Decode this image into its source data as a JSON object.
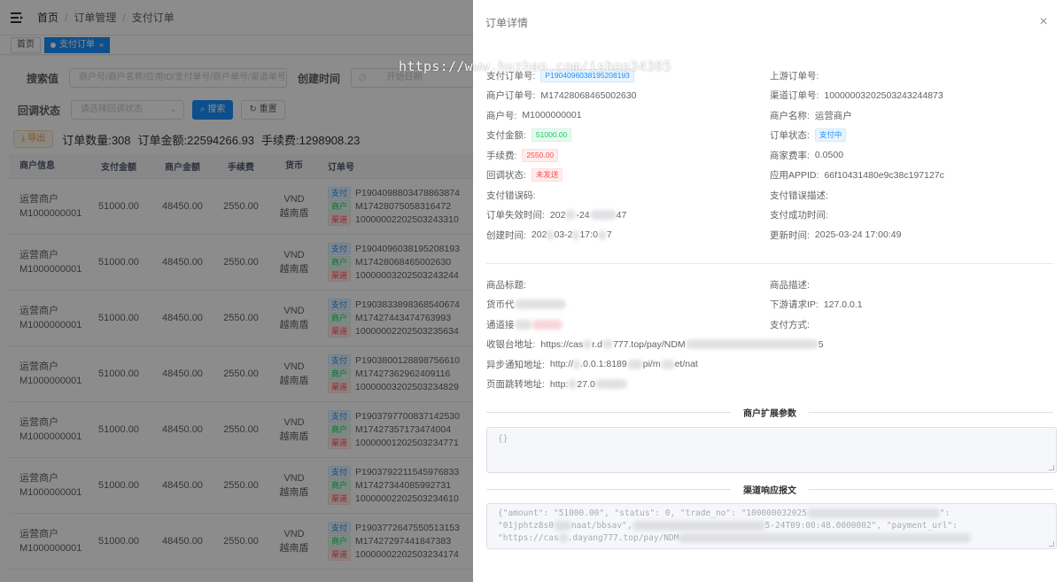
{
  "breadcrumb": {
    "home": "首页",
    "order_mgmt": "订单管理",
    "pay_order": "支付订单"
  },
  "tags": {
    "home": "首页",
    "active": "支付订单",
    "close": "×"
  },
  "filters": {
    "search_label": "搜索值",
    "search_placeholder": "商户号/商户名称/应用ID/支付单号/商户单号/渠道单号",
    "created_label": "创建时间",
    "start_date": "开始日期",
    "callback_label": "回调状态",
    "callback_placeholder": "请选择回调状态",
    "search_btn": "搜索",
    "reset_btn": "重置"
  },
  "summary": {
    "export": "导出",
    "count": "订单数量:308",
    "amount": "订单金额:22594266.93",
    "fee": "手续费:1298908.23"
  },
  "table": {
    "headers": [
      "商户信息",
      "支付金额",
      "商户金额",
      "手续费",
      "货币",
      "订单号"
    ],
    "tag_labels": {
      "pay": "支付",
      "merchant": "商户",
      "channel": "渠道"
    },
    "rows": [
      {
        "name": "运营商户",
        "mid": "M1000000001",
        "pay": "51000.00",
        "merchant": "48450.00",
        "fee": "2550.00",
        "cur": "VND",
        "bank": "越南盾",
        "o1": "P1904098803478863874",
        "o2": "M17428075058316472",
        "o3": "10000002202503243310"
      },
      {
        "name": "运营商户",
        "mid": "M1000000001",
        "pay": "51000.00",
        "merchant": "48450.00",
        "fee": "2550.00",
        "cur": "VND",
        "bank": "越南盾",
        "o1": "P1904096038195208193",
        "o2": "M17428068465002630",
        "o3": "10000003202503243244"
      },
      {
        "name": "运营商户",
        "mid": "M1000000001",
        "pay": "51000.00",
        "merchant": "48450.00",
        "fee": "2550.00",
        "cur": "VND",
        "bank": "越南盾",
        "o1": "P1903833898368540674",
        "o2": "M17427443474763993",
        "o3": "10000002202503235634"
      },
      {
        "name": "运营商户",
        "mid": "M1000000001",
        "pay": "51000.00",
        "merchant": "48450.00",
        "fee": "2550.00",
        "cur": "VND",
        "bank": "越南盾",
        "o1": "P1903800128898756610",
        "o2": "M17427362962409116",
        "o3": "10000003202503234829"
      },
      {
        "name": "运营商户",
        "mid": "M1000000001",
        "pay": "51000.00",
        "merchant": "48450.00",
        "fee": "2550.00",
        "cur": "VND",
        "bank": "越南盾",
        "o1": "P1903797700837142530",
        "o2": "M17427357173474004",
        "o3": "10000001202503234771"
      },
      {
        "name": "运营商户",
        "mid": "M1000000001",
        "pay": "51000.00",
        "merchant": "48450.00",
        "fee": "2550.00",
        "cur": "VND",
        "bank": "越南盾",
        "o1": "P1903792211545976833",
        "o2": "M17427344085992731",
        "o3": "10000002202503234610"
      },
      {
        "name": "运营商户",
        "mid": "M1000000001",
        "pay": "51000.00",
        "merchant": "48450.00",
        "fee": "2550.00",
        "cur": "VND",
        "bank": "越南盾",
        "o1": "P1903772647550513153",
        "o2": "M17427297441847383",
        "o3": "10000002202503234174"
      }
    ]
  },
  "drawer": {
    "title": "订单详情",
    "close": "×",
    "fields": {
      "pay_order_no_k": "支付订单号:",
      "pay_order_no_v": "P1904096038195208193",
      "upstream_no_k": "上游订单号:",
      "merchant_order_k": "商户订单号:",
      "merchant_order_v": "M17428068465002630",
      "channel_order_k": "渠道订单号:",
      "channel_order_v": "10000003202503243244873",
      "merchant_no_k": "商户号:",
      "merchant_no_v": "M1000000001",
      "merchant_name_k": "商户名称:",
      "merchant_name_v": "运营商户",
      "pay_amount_k": "支付金额:",
      "pay_amount_v": "51000.00",
      "order_status_k": "订单状态:",
      "order_status_v": "支付中",
      "fee_k": "手续费:",
      "fee_v": "2550.00",
      "rate_k": "商家费率:",
      "rate_v": "0.0500",
      "callback_k": "回调状态:",
      "callback_v": "未发送",
      "appid_k": "应用APPID:",
      "appid_v": "66f10431480e9c38c197127c",
      "pay_err_code_k": "支付错误码:",
      "pay_err_desc_k": "支付错误描述:",
      "expire_k": "订单失效时间:",
      "expire_v_a": "202",
      "expire_v_b": "-24",
      "expire_v_c": "47",
      "success_k": "支付成功时间:",
      "created_k": "创建时间:",
      "created_v_a": "202",
      "created_v_b": "03-2",
      "created_v_c": "17:0",
      "created_v_d": "7",
      "updated_k": "更新时间:",
      "updated_v": "2025-03-24 17:00:49",
      "subject_k": "商品标题:",
      "desc_k": "商品描述:",
      "currency_k": "货币代",
      "client_ip_k": "下游请求IP:",
      "client_ip_v": "127.0.0.1",
      "channel_k": "通道接",
      "pay_way_k": "支付方式:",
      "cashier_k": "收银台地址:",
      "cashier_v_a": "https://cas",
      "cashier_v_b": "r.d",
      "cashier_v_c": "777.top/pay/NDM",
      "cashier_v_d": "5",
      "notify_k": "异步通知地址:",
      "notify_v_a": "http://",
      "notify_v_b": ".0.0.1:8189",
      "notify_v_c": "pi/m",
      "notify_v_d": "et/nat",
      "return_k": "页面跳转地址:",
      "return_v_a": "http:",
      "return_v_b": "27.0"
    },
    "ext_title": "商户扩展参数",
    "ext_value": "{}",
    "resp_title": "渠道响应报文",
    "resp_line1_a": "{\"amount\": \"51000.00\", \"status\": 0, \"trade_no\": \"100000032025",
    "resp_line1_b": "\":",
    "resp_line2_a": "\"01jphtz8s0",
    "resp_line2_b": "naat/bbsav\",",
    "resp_line2_c": "5-24T09:00:48.0000002\", \"payment_url\":",
    "resp_line3_a": "\"https://cas",
    "resp_line3_b": ".dayang777.top/pay/NDM"
  },
  "watermark": "https://www.huzhan.com/ishop34385",
  "colors": {
    "primary": "#1890ff",
    "success": "#13ce66",
    "danger": "#ff4949",
    "warning": "#e6a23c"
  }
}
